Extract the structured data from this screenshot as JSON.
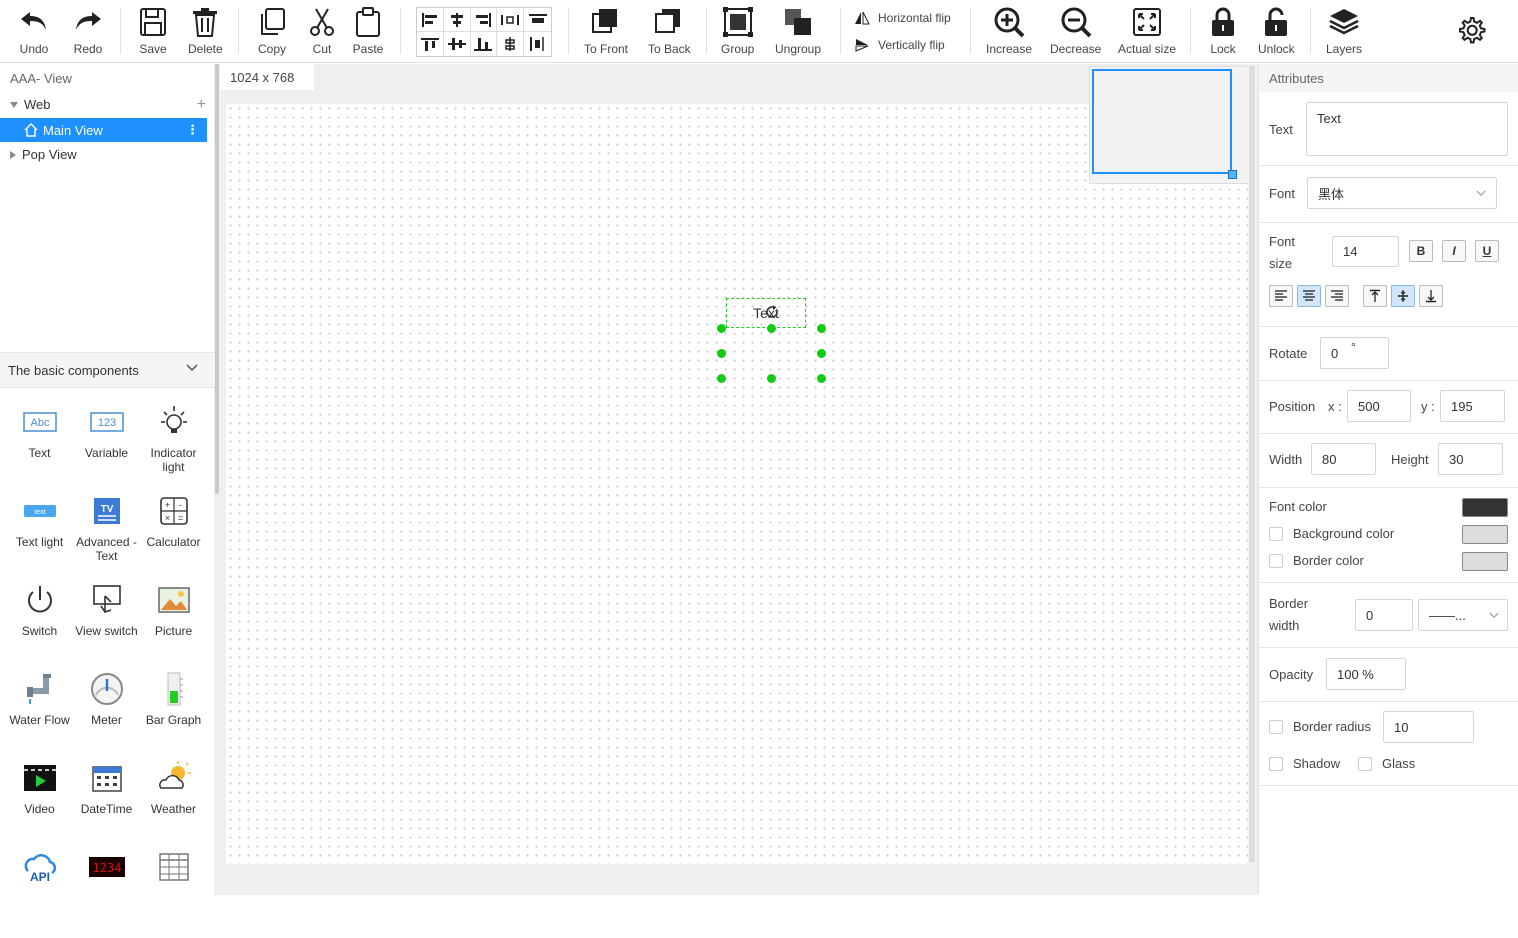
{
  "toolbar": {
    "undo": "Undo",
    "redo": "Redo",
    "save": "Save",
    "delete": "Delete",
    "copy": "Copy",
    "cut": "Cut",
    "paste": "Paste",
    "to_front": "To Front",
    "to_back": "To Back",
    "group": "Group",
    "ungroup": "Ungroup",
    "horizontal_flip": "Horizontal flip",
    "vertically_flip": "Vertically flip",
    "increase": "Increase",
    "decrease": "Decrease",
    "actual_size": "Actual size",
    "lock": "Lock",
    "unlock": "Unlock",
    "layers": "Layers"
  },
  "project": {
    "title": "AAA- View",
    "root": "Web",
    "views": [
      "Main View",
      "Pop View"
    ],
    "selected_view": "Main View"
  },
  "components": {
    "header": "The basic components",
    "items": [
      {
        "label": "Text",
        "icon": "text-abc-icon"
      },
      {
        "label": "Variable",
        "icon": "variable-123-icon"
      },
      {
        "label": "Indicator light",
        "icon": "light-bulb-icon"
      },
      {
        "label": "Text light",
        "icon": "text-light-icon"
      },
      {
        "label": "Advanced - Text",
        "icon": "advanced-text-icon"
      },
      {
        "label": "Calculator",
        "icon": "calculator-icon"
      },
      {
        "label": "Switch",
        "icon": "power-icon"
      },
      {
        "label": "View switch",
        "icon": "view-switch-icon"
      },
      {
        "label": "Picture",
        "icon": "picture-icon"
      },
      {
        "label": "Water Flow",
        "icon": "water-pipe-icon"
      },
      {
        "label": "Meter",
        "icon": "meter-gauge-icon"
      },
      {
        "label": "Bar Graph",
        "icon": "bar-graph-icon"
      },
      {
        "label": "Video",
        "icon": "video-clapper-icon"
      },
      {
        "label": "DateTime",
        "icon": "calendar-icon"
      },
      {
        "label": "Weather",
        "icon": "weather-icon"
      },
      {
        "label": "",
        "icon": "api-cloud-icon"
      },
      {
        "label": "",
        "icon": "digital-display-icon"
      },
      {
        "label": "",
        "icon": "table-grid-icon"
      }
    ]
  },
  "canvas": {
    "size_label": "1024  x  768",
    "selected_element_text": "Text"
  },
  "attributes": {
    "title": "Attributes",
    "text_label": "Text",
    "text_value": "Text",
    "font_label": "Font",
    "font_value": "黑体",
    "font_size_label_1": "Font",
    "font_size_label_2": "size",
    "font_size_value": "14",
    "bold": "B",
    "italic": "I",
    "underline": "U",
    "rotate_label": "Rotate",
    "rotate_value": "0",
    "rotate_unit": "°",
    "position_label": "Position",
    "x_label": "x :",
    "x_value": "500",
    "y_label": "y :",
    "y_value": "195",
    "width_label": "Width",
    "width_value": "80",
    "height_label": "Height",
    "height_value": "30",
    "font_color_label": "Font color",
    "font_color": "#333333",
    "background_color_label": "Background color",
    "background_color": "#dddddd",
    "border_color_label": "Border color",
    "border_color": "#dddddd",
    "border_width_label_1": "Border",
    "border_width_label_2": "width",
    "border_width_value": "0",
    "border_style_value": "——...",
    "opacity_label": "Opacity",
    "opacity_value": "100  %",
    "border_radius_label": "Border radius",
    "border_radius_value": "10",
    "shadow_label": "Shadow",
    "glass_label": "Glass"
  },
  "colors": {
    "accent": "#1e90ff",
    "handle": "#11cc11"
  }
}
